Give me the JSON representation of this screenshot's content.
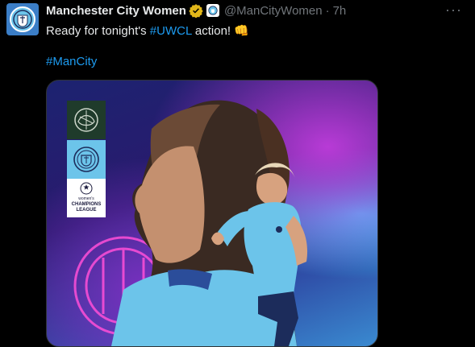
{
  "tweet": {
    "display_name": "Manchester City Women",
    "handle": "@ManCityWomen",
    "separator": "·",
    "time": "7h",
    "more_label": "···",
    "text_before": "Ready for tonight's ",
    "text_hashtag": "#UWCL",
    "text_after": " action! ",
    "emoji": "👊",
    "hashtag_line": "#ManCity"
  },
  "media": {
    "badge_lines": [
      "women's",
      "CHAMPIONS",
      "LEAGUE"
    ]
  },
  "colors": {
    "link": "#1d9bf0",
    "muted": "#71767b",
    "verified": "#e2b719",
    "city_blue": "#6cc4ea"
  }
}
